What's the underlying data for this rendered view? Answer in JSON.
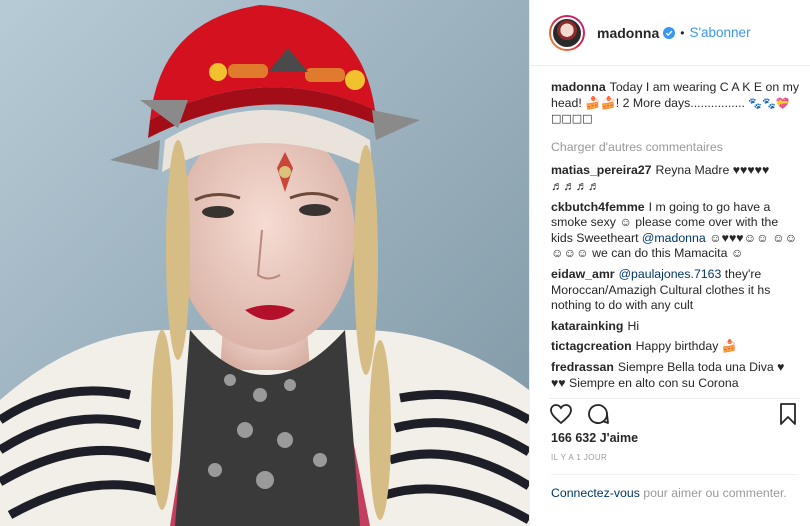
{
  "post": {
    "username": "madonna",
    "follow_label": "S'abonner",
    "caption_user": "madonna",
    "caption_text": "Today I am wearing C A K E on my head! 🍰🍰! 2 More days................",
    "caption_emoji": "🐾🐾💝 □□□□",
    "load_more": "Charger d'autres commentaires",
    "comments": [
      {
        "author": "matias_pereira27",
        "text": "Reyna Madre ♥♥♥♥♥ ♬♬♬♬"
      },
      {
        "author": "ckbutch4femme",
        "text": "I m going to go have a smoke sexy ☺ please come over with the kids Sweetheart",
        "mention": "@madonna",
        "text2": "☺♥♥♥☺☺ ☺☺☺☺☺ we can do this Mamacita ☺"
      },
      {
        "author": "eidaw_amr",
        "mention": "@paulajones.7163",
        "text2": "they're Moroccan/Amazigh Cultural clothes it hs nothing to do with any cult"
      },
      {
        "author": "katarainking",
        "text": "Hi"
      },
      {
        "author": "tictagcreation",
        "text": "Happy birthday 🍰"
      },
      {
        "author": "fredrassan",
        "text": "Siempre Bella toda una Diva ♥ ♥♥ Siempre en alto con su Corona"
      }
    ],
    "likes": "166 632 J'aime",
    "time_ago": "IL Y A 1 JOUR",
    "login_link": "Connectez-vous",
    "login_text": "pour aimer ou commenter."
  },
  "icons": {
    "like": "heart-icon",
    "comment": "speech-bubble-icon",
    "save": "bookmark-icon",
    "verified": "verified-badge-icon"
  },
  "colors": {
    "link": "#3897f0",
    "mention": "#003569",
    "muted": "#999999"
  }
}
